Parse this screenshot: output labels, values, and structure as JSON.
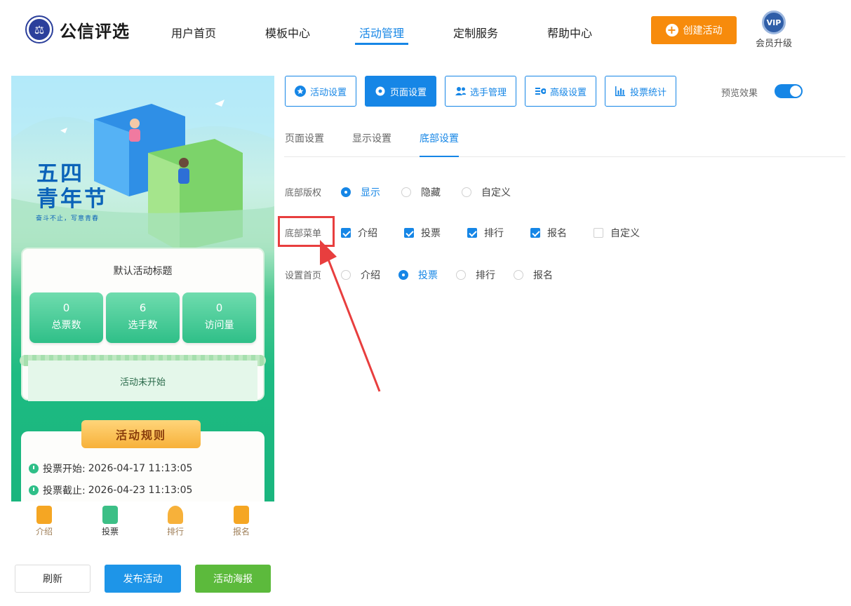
{
  "header": {
    "logo_text": "公信评选",
    "nav": [
      "用户首页",
      "模板中心",
      "活动管理",
      "定制服务",
      "帮助中心"
    ],
    "active_nav": "活动管理",
    "create_button": "创建活动",
    "vip_badge": "VIP",
    "vip_label": "会员升级",
    "accent_color": "#1686e6",
    "create_color": "#f78b0c"
  },
  "preview": {
    "banner_title_line1": "五四",
    "banner_title_line2": "青年节",
    "banner_subtitle": "奋斗不止，写意青春",
    "activity_title": "默认活动标题",
    "stats": [
      {
        "value": "0",
        "label": "总票数"
      },
      {
        "value": "6",
        "label": "选手数"
      },
      {
        "value": "0",
        "label": "访问量"
      }
    ],
    "status": "活动未开始",
    "rules_title": "活动规则",
    "rules": [
      {
        "label": "投票开始:",
        "value": "2026-04-17 11:13:05"
      },
      {
        "label": "投票截止:",
        "value": "2026-04-23 11:13:05"
      }
    ],
    "tabbar": [
      {
        "label": "介绍",
        "icon": "document-icon"
      },
      {
        "label": "投票",
        "icon": "vote-box-icon"
      },
      {
        "label": "排行",
        "icon": "trophy-icon"
      },
      {
        "label": "报名",
        "icon": "signup-form-icon"
      }
    ],
    "active_tab": "投票"
  },
  "actions": {
    "refresh": "刷新",
    "publish": "发布活动",
    "poster": "活动海报"
  },
  "toolbar": {
    "buttons": [
      {
        "label": "活动设置",
        "icon": "star-icon"
      },
      {
        "label": "页面设置",
        "icon": "gear-icon"
      },
      {
        "label": "选手管理",
        "icon": "users-icon"
      },
      {
        "label": "高级设置",
        "icon": "advanced-settings-icon"
      },
      {
        "label": "投票统计",
        "icon": "bar-chart-icon"
      }
    ],
    "active": "页面设置",
    "preview_label": "预览效果",
    "preview_on": true
  },
  "subtabs": {
    "items": [
      "页面设置",
      "显示设置",
      "底部设置"
    ],
    "active": "底部设置"
  },
  "settings": {
    "copyright": {
      "label": "底部版权",
      "options": [
        "显示",
        "隐藏",
        "自定义"
      ],
      "selected": "显示"
    },
    "menu": {
      "label": "底部菜单",
      "options": [
        {
          "label": "介绍",
          "checked": true
        },
        {
          "label": "投票",
          "checked": true
        },
        {
          "label": "排行",
          "checked": true
        },
        {
          "label": "报名",
          "checked": true
        },
        {
          "label": "自定义",
          "checked": false
        }
      ]
    },
    "homepage": {
      "label": "设置首页",
      "options": [
        "介绍",
        "投票",
        "排行",
        "报名"
      ],
      "selected": "投票"
    }
  },
  "annotation_color": "#e83e3e"
}
